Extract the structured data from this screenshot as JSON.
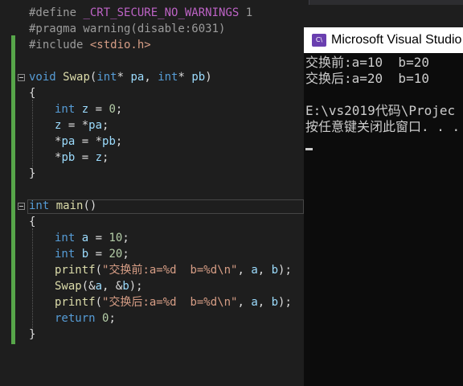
{
  "editor": {
    "lines": [
      [
        "#define ",
        "_CRT_SECURE_NO_WARNINGS",
        " 1"
      ],
      [
        "#pragma warning(disable:6031)"
      ],
      [
        "#include ",
        "<stdio.h>"
      ],
      [
        "void",
        " ",
        "Swap",
        "(",
        "int",
        "* ",
        "pa",
        ", ",
        "int",
        "* ",
        "pb",
        ")"
      ],
      [
        "{"
      ],
      [
        "int",
        " ",
        "z",
        " = ",
        "0",
        ";"
      ],
      [
        "z",
        " = *",
        "pa",
        ";"
      ],
      [
        "*",
        "pa",
        " = *",
        "pb",
        ";"
      ],
      [
        "*",
        "pb",
        " = ",
        "z",
        ";"
      ],
      [
        "}"
      ],
      [
        "int",
        " ",
        "main",
        "()"
      ],
      [
        "{"
      ],
      [
        "int",
        " ",
        "a",
        " = ",
        "10",
        ";"
      ],
      [
        "int",
        " ",
        "b",
        " = ",
        "20",
        ";"
      ],
      [
        "printf",
        "(",
        "\"交换前:a=%d  b=%d\\n\"",
        ", ",
        "a",
        ", ",
        "b",
        ");"
      ],
      [
        "Swap",
        "(&",
        "a",
        ", &",
        "b",
        ");"
      ],
      [
        "printf",
        "(",
        "\"交换后:a=%d  b=%d\\n\"",
        ", ",
        "a",
        ", ",
        "b",
        ");"
      ],
      [
        "return",
        " ",
        "0",
        ";"
      ],
      [
        "}"
      ]
    ]
  },
  "console": {
    "title": "Microsoft Visual Studio",
    "icon": "console-app-icon",
    "icon_text": "C\\",
    "output": [
      "交换前:a=10  b=20",
      "交换后:a=20  b=10",
      "",
      "E:\\vs2019代码\\Projec",
      "按任意键关闭此窗口. . ."
    ]
  }
}
